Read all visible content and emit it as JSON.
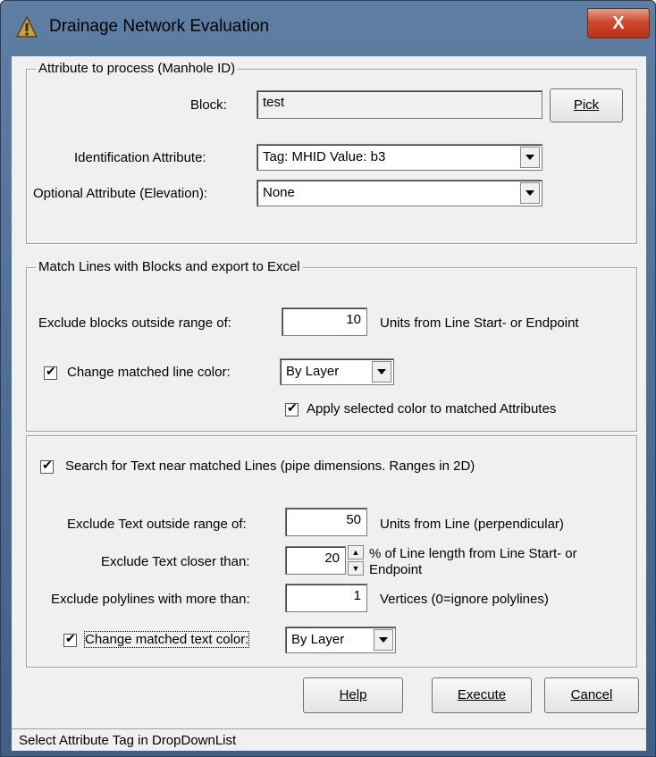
{
  "window": {
    "title": "Drainage Network Evaluation",
    "close_label": "X",
    "app_icon": "hazard-icon"
  },
  "group1": {
    "title": "Attribute to process (Manhole ID)",
    "block_label": "Block:",
    "block_value": "test",
    "pick_button": "Pick",
    "id_attr_label": "Identification Attribute:",
    "id_attr_value": "Tag: MHID  Value: b3",
    "opt_attr_label": "Optional Attribute (Elevation):",
    "opt_attr_value": "None"
  },
  "group2": {
    "title": "Match Lines with Blocks and export to Excel",
    "exclude_label": "Exclude blocks outside range of:",
    "exclude_value": "10",
    "exclude_units": "Units from Line Start- or Endpoint",
    "change_color_label": "Change matched line color:",
    "change_color_value": "By Layer",
    "apply_color_label": "Apply selected color to matched Attributes"
  },
  "group3": {
    "search_label": "Search for Text near matched Lines (pipe dimensions. Ranges in 2D)",
    "text_range_label": "Exclude Text outside range of:",
    "text_range_value": "50",
    "text_range_units": "Units from Line (perpendicular)",
    "closer_label": "Exclude Text closer than:",
    "closer_value": "20",
    "closer_units_line1": "% of Line length from Line Start- or",
    "closer_units_line2": "Endpoint",
    "poly_label": "Exclude polylines with more than:",
    "poly_value": "1",
    "poly_units": "Vertices (0=ignore polylines)",
    "text_color_label": "Change matched text color:",
    "text_color_value": "By Layer"
  },
  "buttons": {
    "help": "Help",
    "execute": "Execute",
    "cancel": "Cancel"
  },
  "status": {
    "text": "Select Attribute Tag in DropDownList"
  },
  "colors": {
    "frame": "#4a6d94",
    "client": "#f0f0f0",
    "close_button": "#c8442a"
  }
}
